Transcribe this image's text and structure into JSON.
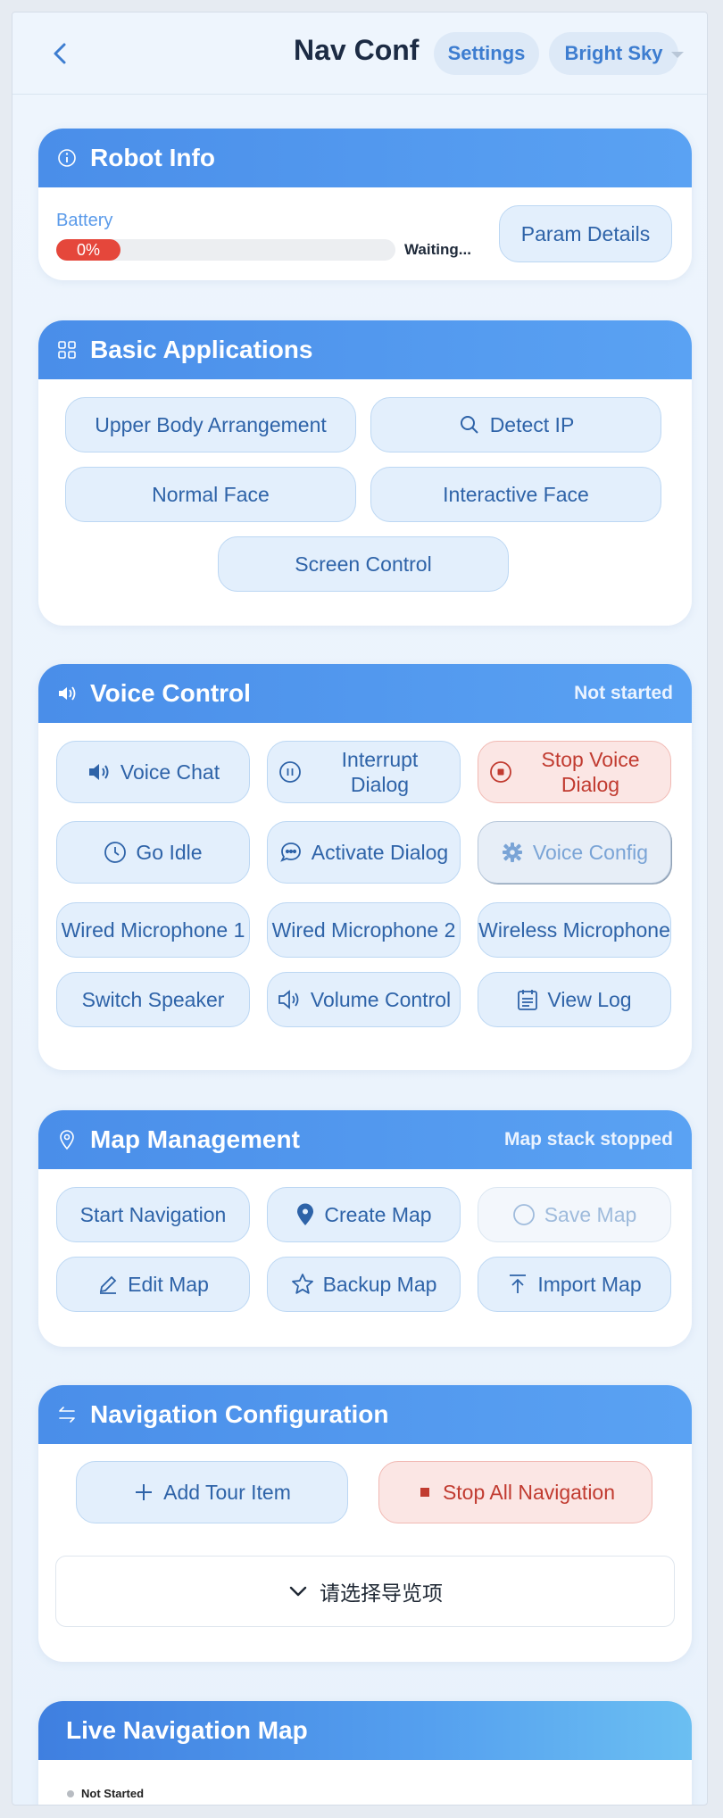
{
  "header": {
    "back_icon": "chevron-left-icon",
    "title": "Nav Conf",
    "settings_label": "Settings",
    "theme_label": "Bright Sky"
  },
  "robot_info": {
    "title": "Robot Info",
    "battery_label": "Battery",
    "battery_level": 0,
    "battery_text": "0%",
    "battery_color": "#e5473b",
    "battery_status": "Waiting...",
    "param_details_label": "Param Details"
  },
  "basic_apps": {
    "title": "Basic Applications",
    "upper_body": "Upper Body Arrangement",
    "detect_ip": "Detect IP",
    "normal_face": "Normal Face",
    "interactive_face": "Interactive Face",
    "screen_control": "Screen Control"
  },
  "voice": {
    "title": "Voice Control",
    "status": "Not started",
    "voice_chat": "Voice Chat",
    "interrupt_dialog": "Interrupt Dialog",
    "stop_voice_dialog": "Stop Voice Dialog",
    "go_idle": "Go Idle",
    "activate_dialog": "Activate Dialog",
    "voice_config": "Voice Config",
    "wired_mic_1": "Wired Microphone 1",
    "wired_mic_2": "Wired Microphone 2",
    "wireless_mic": "Wireless Microphone",
    "switch_speaker": "Switch Speaker",
    "volume_control": "Volume Control",
    "view_log": "View Log"
  },
  "map": {
    "title": "Map Management",
    "status": "Map stack stopped",
    "start_navigation": "Start Navigation",
    "create_map": "Create Map",
    "save_map": "Save Map",
    "edit_map": "Edit Map",
    "backup_map": "Backup Map",
    "import_map": "Import Map"
  },
  "nav_config": {
    "title": "Navigation Configuration",
    "add_tour_item": "Add Tour Item",
    "stop_all_navigation": "Stop All Navigation",
    "tour_select_placeholder": "请选择导览项"
  },
  "live_map": {
    "title": "Live Navigation Map",
    "status": "Not Started"
  },
  "colors": {
    "accent": "#4a8ee9",
    "danger": "#c13b30",
    "button_bg": "#e3effc"
  }
}
